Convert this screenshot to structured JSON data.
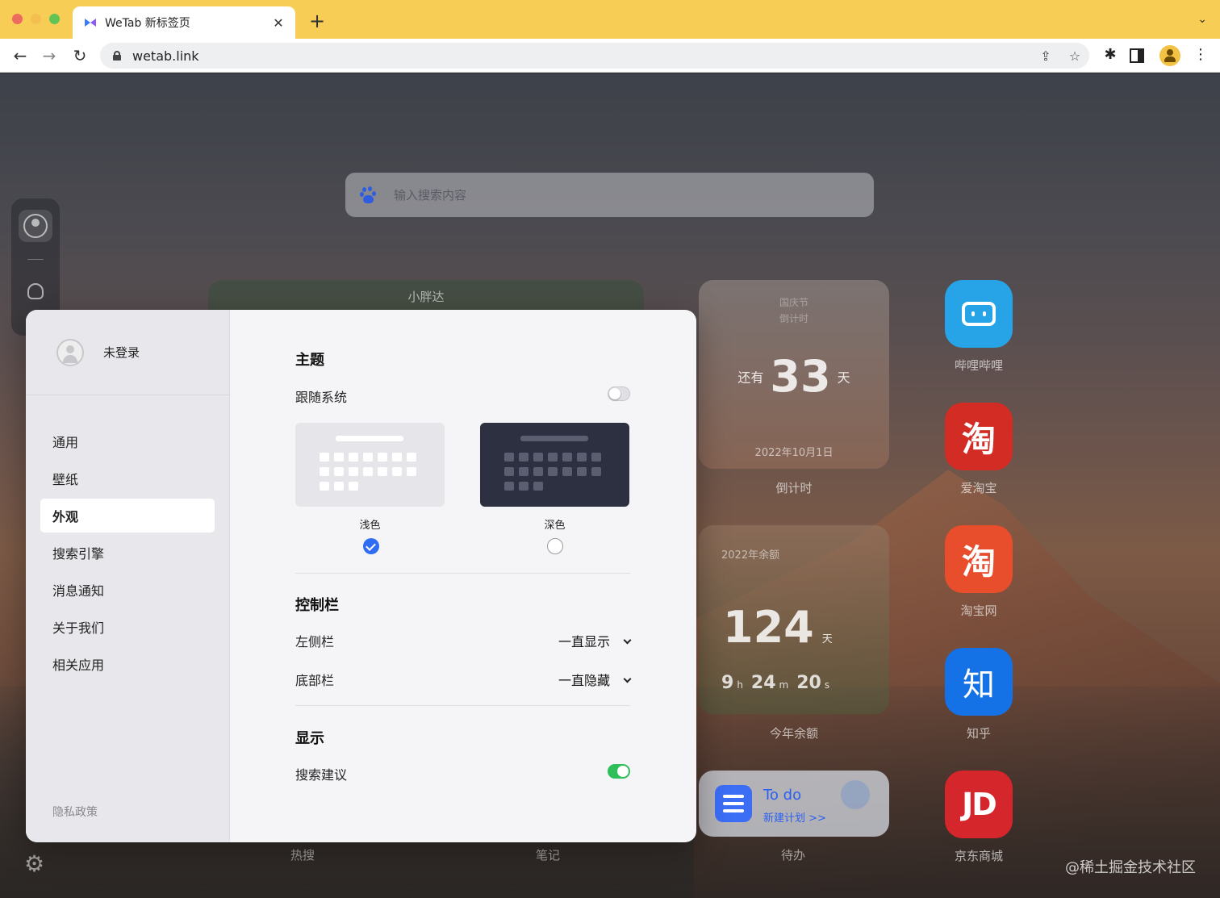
{
  "browser": {
    "tab_title": "WeTab 新标签页",
    "tab_close": "✕",
    "new_tab": "+",
    "tab_menu": "⌄",
    "url": "wetab.link",
    "nav": {
      "back": "←",
      "forward": "→",
      "reload": "↻"
    },
    "icons": {
      "share": "⇪",
      "bookmark": "☆",
      "extensions": "✱",
      "menu": "⋮"
    }
  },
  "page": {
    "search_placeholder": "输入搜索内容",
    "widgets": {
      "xiaopangda": "小胖达",
      "countdown": {
        "holiday": "国庆节",
        "subtitle": "倒计时",
        "prefix": "还有",
        "days": "33",
        "unit": "天",
        "date": "2022年10月1日",
        "label": "倒计时"
      },
      "year_remaining": {
        "title": "2022年余额",
        "days": "124",
        "unit": "天",
        "hours": "9",
        "h": "h",
        "minutes": "24",
        "m": "m",
        "seconds": "20",
        "s": "s",
        "label": "今年余额"
      },
      "todo": {
        "title": "To do",
        "subtitle": "新建计划 >>",
        "label": "待办"
      }
    },
    "apps": [
      {
        "label": "哔哩哔哩",
        "glyph": ""
      },
      {
        "label": "爱淘宝",
        "glyph": "淘"
      },
      {
        "label": "淘宝网",
        "glyph": "淘"
      },
      {
        "label": "知乎",
        "glyph": "知"
      },
      {
        "label": "京东商城",
        "glyph": "JD"
      }
    ],
    "bottom_labels": {
      "hot": "热搜",
      "notes": "笔记"
    },
    "watermark": "@稀土掘金技术社区"
  },
  "settings": {
    "user": "未登录",
    "menu": [
      "通用",
      "壁纸",
      "外观",
      "搜索引擎",
      "消息通知",
      "关于我们",
      "相关应用"
    ],
    "active_menu": "外观",
    "privacy": "隐私政策",
    "theme": {
      "title": "主题",
      "follow_system": "跟随系统",
      "follow_system_on": false,
      "light": "浅色",
      "dark": "深色",
      "selected": "浅色"
    },
    "control_bar": {
      "title": "控制栏",
      "left_label": "左侧栏",
      "left_value": "一直显示",
      "bottom_label": "底部栏",
      "bottom_value": "一直隐藏"
    },
    "display": {
      "title": "显示",
      "search_suggest": "搜索建议",
      "search_suggest_on": true
    }
  }
}
